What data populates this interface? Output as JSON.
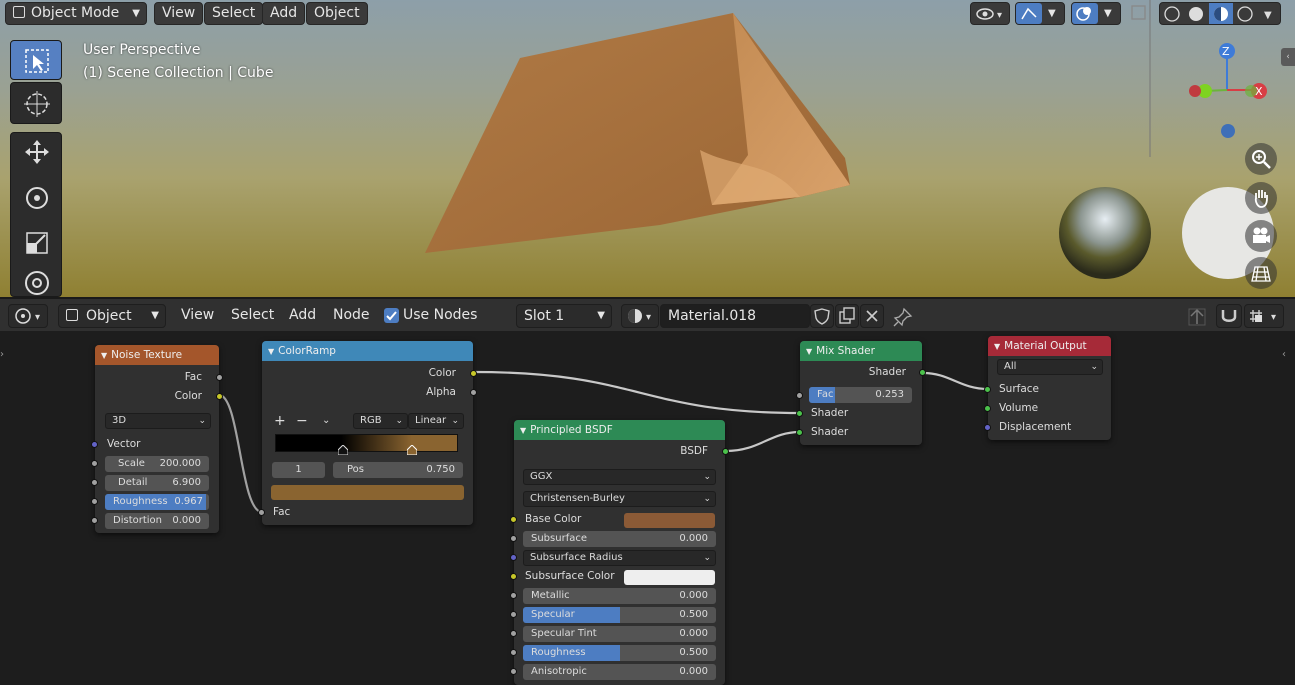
{
  "viewport": {
    "mode_label": "Object Mode",
    "menu": [
      "View",
      "Select",
      "Add",
      "Object"
    ],
    "overlay_line1": "User Perspective",
    "overlay_line2": "(1) Scene Collection | Cube",
    "axes": {
      "z": "Z",
      "x": "X"
    }
  },
  "node_header": {
    "editor_type_icon": "node-editor-icon",
    "object_label": "Object",
    "menu": [
      "View",
      "Select",
      "Add",
      "Node"
    ],
    "use_nodes_label": "Use Nodes",
    "use_nodes_checked": true,
    "slot_label": "Slot 1",
    "material_name": "Material.018"
  },
  "nodes": {
    "noise": {
      "title": "Noise Texture",
      "out_fac": "Fac",
      "out_color": "Color",
      "dim": "3D",
      "in_vector": "Vector",
      "scale_label": "Scale",
      "scale_value": "200.000",
      "detail_label": "Detail",
      "detail_value": "6.900",
      "roughness_label": "Roughness",
      "roughness_value": "0.967",
      "roughness_fill": 0.967,
      "distortion_label": "Distortion",
      "distortion_value": "0.000"
    },
    "colorramp": {
      "title": "ColorRamp",
      "out_color": "Color",
      "out_alpha": "Alpha",
      "color_mode": "RGB",
      "interp": "Linear",
      "stop_index": "1",
      "pos_label": "Pos",
      "pos_value": "0.750",
      "in_fac": "Fac",
      "stop_color": "#8a6430"
    },
    "bsdf": {
      "title": "Principled BSDF",
      "out": "BSDF",
      "distribution": "GGX",
      "sss_method": "Christensen-Burley",
      "base_color_label": "Base Color",
      "base_color": "#8b5a36",
      "subsurface_label": "Subsurface",
      "subsurface_value": "0.000",
      "subsurface_radius_label": "Subsurface Radius",
      "subsurface_color_label": "Subsurface Color",
      "subsurface_color": "#eeeeee",
      "metallic_label": "Metallic",
      "metallic_value": "0.000",
      "specular_label": "Specular",
      "specular_value": "0.500",
      "specular_fill": 0.5,
      "specular_tint_label": "Specular Tint",
      "specular_tint_value": "0.000",
      "roughness_label": "Roughness",
      "roughness_value": "0.500",
      "roughness_fill": 0.5,
      "anisotropic_label": "Anisotropic",
      "anisotropic_value": "0.000"
    },
    "mix": {
      "title": "Mix Shader",
      "out": "Shader",
      "fac_label": "Fac",
      "fac_value": "0.253",
      "fac_fill": 0.253,
      "in1": "Shader",
      "in2": "Shader"
    },
    "output": {
      "title": "Material Output",
      "target": "All",
      "surface": "Surface",
      "volume": "Volume",
      "displacement": "Displacement"
    }
  },
  "colors": {
    "noise_header": "#a4562b",
    "colorramp_header": "#3f88b8",
    "bsdf_header": "#2d8a55",
    "mix_header": "#2d8a55",
    "output_header": "#a62a38",
    "accent": "#4d7dc2"
  }
}
